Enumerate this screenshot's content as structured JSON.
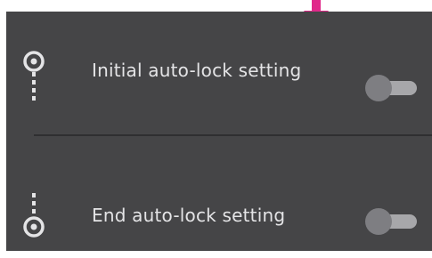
{
  "colors": {
    "panel_background": "#454547",
    "text": "#e4e4e6",
    "toggle_track": "#a7a7aa",
    "toggle_knob": "#7e7e82",
    "callout_arrow": "#e0288a"
  },
  "settings": [
    {
      "label": "Initial auto-lock setting",
      "icon": "lock-start-icon",
      "enabled": false
    },
    {
      "label": "End auto-lock setting",
      "icon": "lock-end-icon",
      "enabled": false
    }
  ]
}
